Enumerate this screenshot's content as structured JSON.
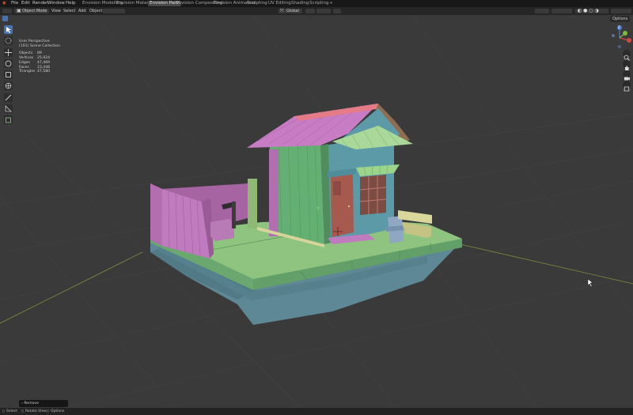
{
  "menu": {
    "items": [
      "File",
      "Edit",
      "Render",
      "Window",
      "Help"
    ]
  },
  "workspace_tabs": [
    {
      "label": "Envision Modelling",
      "active": false
    },
    {
      "label": "Envision Materials",
      "active": false
    },
    {
      "label": "Envision Paint",
      "active": true
    },
    {
      "label": "Envision Compositing",
      "active": false
    },
    {
      "label": "Envision Animation",
      "active": false
    },
    {
      "label": "Sculpting",
      "active": false
    },
    {
      "label": "UV Editing",
      "active": false
    },
    {
      "label": "Shading",
      "active": false
    },
    {
      "label": "Scripting",
      "active": false
    }
  ],
  "add_tab_label": "+",
  "header": {
    "mode": "Object Mode",
    "view": "View",
    "select": "Select",
    "add": "Add",
    "object": "Object",
    "orientation": "Global",
    "options": "Options"
  },
  "overlay": {
    "view_name": "User Perspective",
    "collection": "(101) Scene Collection",
    "stats": [
      {
        "label": "Objects",
        "value": "89"
      },
      {
        "label": "Vertices",
        "value": "25,924"
      },
      {
        "label": "Edges",
        "value": "47,469"
      },
      {
        "label": "Faces",
        "value": "23,448"
      },
      {
        "label": "Triangles",
        "value": "47,580"
      }
    ]
  },
  "gizmo": {
    "z": "Z",
    "y": "Y",
    "x": "X"
  },
  "scene": {
    "axis_label": "Y"
  },
  "last_operation": "Remove",
  "status": {
    "select": "Select",
    "rotate": "Rotate View",
    "options": "Options"
  },
  "colors": {
    "accent": "#4772b3",
    "roof": "#b26fb0",
    "walls": "#5fa56b",
    "water": "#5e8895",
    "door": "#a65a4e"
  }
}
